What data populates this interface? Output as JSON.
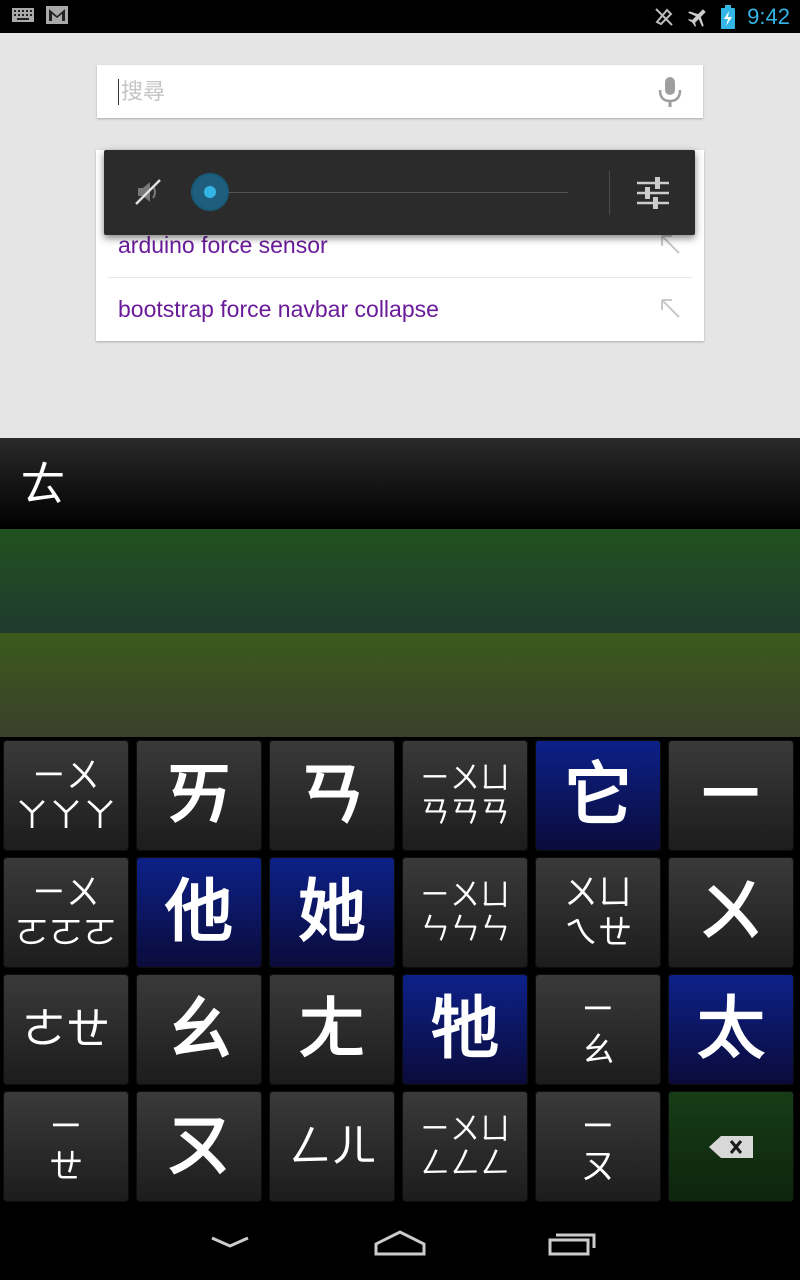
{
  "statusbar": {
    "time": "9:42",
    "left_icons": [
      "keyboard-icon",
      "gmail-icon"
    ],
    "right_icons": [
      "vibrate-off-icon",
      "airplane-mode-icon",
      "battery-charging-icon"
    ],
    "accent": "#33b5e5"
  },
  "search": {
    "placeholder": "搜尋",
    "value": ""
  },
  "suggestions": [
    {
      "text": "arduino force sensor"
    },
    {
      "text": "bootstrap force navbar collapse"
    }
  ],
  "volume": {
    "level": 0,
    "muted": true
  },
  "candidate_bar": {
    "composing": "ㄊ"
  },
  "keyboard": {
    "rows": [
      [
        {
          "label": "ㄧㄨ\nㄚㄚㄚ",
          "style": "small",
          "color": "dark"
        },
        {
          "label": "ㄞ",
          "style": "big",
          "color": "dark"
        },
        {
          "label": "ㄢ",
          "style": "big",
          "color": "dark"
        },
        {
          "label": "ㄧㄨㄩ\nㄢㄢㄢ",
          "style": "tiny",
          "color": "dark"
        },
        {
          "label": "它",
          "style": "big",
          "color": "blue"
        },
        {
          "label": "ㄧ",
          "style": "big",
          "color": "dark"
        }
      ],
      [
        {
          "label": "ㄧㄨ\nㄛㄛㄛ",
          "style": "small",
          "color": "dark"
        },
        {
          "label": "他",
          "style": "big",
          "color": "blue"
        },
        {
          "label": "她",
          "style": "big",
          "color": "blue"
        },
        {
          "label": "ㄧㄨㄩ\nㄣㄣㄣ",
          "style": "tiny",
          "color": "dark"
        },
        {
          "label": "ㄨㄩ\nㄟㄝ",
          "style": "small",
          "color": "dark"
        },
        {
          "label": "ㄨ",
          "style": "big",
          "color": "dark"
        }
      ],
      [
        {
          "label": "ㄜㄝ",
          "style": "med",
          "color": "dark"
        },
        {
          "label": "ㄠ",
          "style": "big",
          "color": "dark"
        },
        {
          "label": "ㄤ",
          "style": "big",
          "color": "dark"
        },
        {
          "label": "牠",
          "style": "big",
          "color": "blue"
        },
        {
          "label": "ㄧ\nㄠ",
          "style": "small",
          "color": "dark"
        },
        {
          "label": "太",
          "style": "big",
          "color": "blue"
        }
      ],
      [
        {
          "label": "ㄧ\nㄝ",
          "style": "small",
          "color": "dark"
        },
        {
          "label": "ㄡ",
          "style": "big",
          "color": "dark"
        },
        {
          "label": "ㄥㄦ",
          "style": "med",
          "color": "dark"
        },
        {
          "label": "ㄧㄨㄩ\nㄥㄥㄥ",
          "style": "tiny",
          "color": "dark"
        },
        {
          "label": "ㄧ\nㄡ",
          "style": "small",
          "color": "dark"
        },
        {
          "label": "",
          "style": "icon",
          "color": "green",
          "icon": "backspace-icon"
        }
      ]
    ]
  },
  "navbar": {
    "icons": [
      "back-down-icon",
      "home-icon",
      "recents-icon"
    ]
  }
}
